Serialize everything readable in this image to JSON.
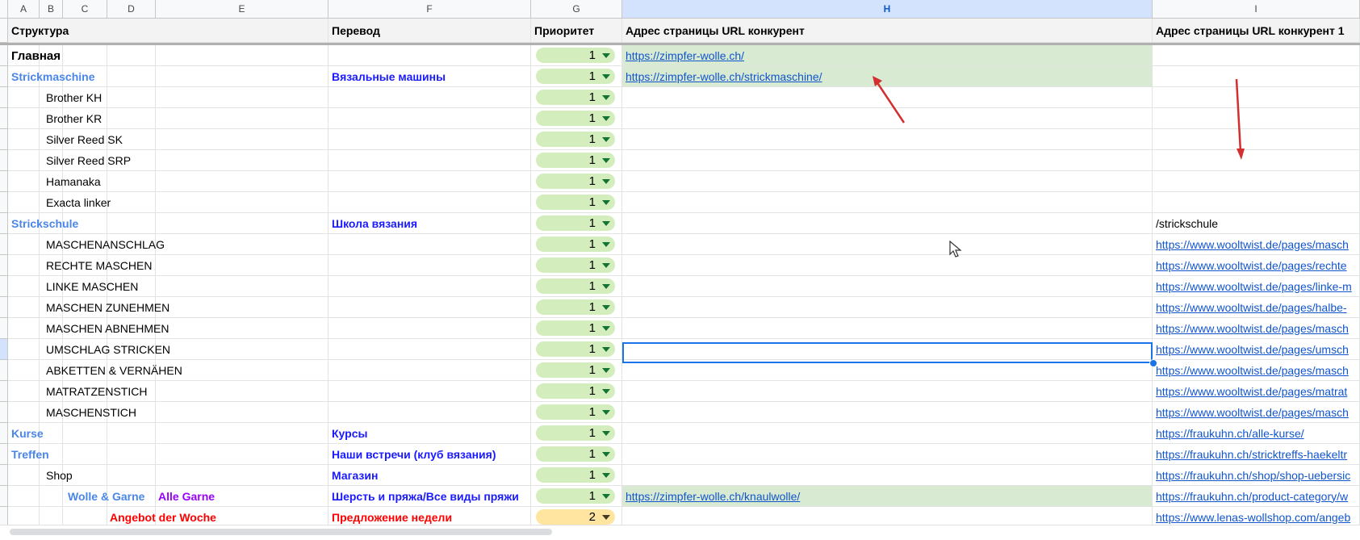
{
  "columns": [
    "A",
    "B",
    "C",
    "D",
    "E",
    "F",
    "G",
    "H",
    "I"
  ],
  "selected_column": "H",
  "header": {
    "structure": "Структура",
    "translation": "Перевод",
    "priority": "Приоритет",
    "url_competitor": "Адрес страницы URL конкурент",
    "url_competitor_1": "Адрес страницы URL конкурент 1"
  },
  "rows": [
    {
      "text": "Главная",
      "col": "A",
      "style": "bold",
      "translation": "",
      "priority": "1",
      "h": "https://zimpfer-wolle.ch/",
      "h_green": true,
      "i": ""
    },
    {
      "text": "Strickmaschine",
      "col": "A",
      "style": "lightblue",
      "translation": "Вязальные машины",
      "priority": "1",
      "h": "https://zimpfer-wolle.ch/strickmaschine/",
      "h_green": true,
      "i": ""
    },
    {
      "text": "Brother KH",
      "col": "C",
      "style": "",
      "translation": "",
      "priority": "1",
      "h": "",
      "h_green": false,
      "i": ""
    },
    {
      "text": "Brother KR",
      "col": "C",
      "style": "",
      "translation": "",
      "priority": "1",
      "h": "",
      "h_green": false,
      "i": ""
    },
    {
      "text": "Silver Reed SK",
      "col": "C",
      "style": "",
      "translation": "",
      "priority": "1",
      "h": "",
      "h_green": false,
      "i": ""
    },
    {
      "text": "Silver Reed SRP",
      "col": "C",
      "style": "",
      "translation": "",
      "priority": "1",
      "h": "",
      "h_green": false,
      "i": ""
    },
    {
      "text": "Hamanaka",
      "col": "C",
      "style": "",
      "translation": "",
      "priority": "1",
      "h": "",
      "h_green": false,
      "i": ""
    },
    {
      "text": "Exacta linker",
      "col": "C",
      "style": "",
      "translation": "",
      "priority": "1",
      "h": "",
      "h_green": false,
      "i": ""
    },
    {
      "text": "Strickschule",
      "col": "A",
      "style": "lightblue",
      "translation": "Школа вязания",
      "priority": "1",
      "h": "",
      "h_green": false,
      "i": "/strickschule",
      "i_plain": true
    },
    {
      "text": "MASCHENANSCHLAG",
      "col": "C",
      "style": "",
      "translation": "",
      "priority": "1",
      "h": "",
      "h_green": false,
      "i": "https://www.wooltwist.de/pages/masch"
    },
    {
      "text": "RECHTE MASCHEN",
      "col": "C",
      "style": "",
      "translation": "",
      "priority": "1",
      "h": "",
      "h_green": false,
      "i": "https://www.wooltwist.de/pages/rechte"
    },
    {
      "text": "LINKE MASCHEN",
      "col": "C",
      "style": "",
      "translation": "",
      "priority": "1",
      "h": "",
      "h_green": false,
      "i": "https://www.wooltwist.de/pages/linke-m"
    },
    {
      "text": "MASCHEN ZUNEHMEN",
      "col": "C",
      "style": "",
      "translation": "",
      "priority": "1",
      "h": "",
      "h_green": false,
      "i": "https://www.wooltwist.de/pages/halbe-"
    },
    {
      "text": "MASCHEN ABNEHMEN",
      "col": "C",
      "style": "",
      "translation": "",
      "priority": "1",
      "h": "",
      "h_green": false,
      "i": "https://www.wooltwist.de/pages/masch"
    },
    {
      "text": "UMSCHLAG STRICKEN",
      "col": "C",
      "style": "",
      "translation": "",
      "priority": "1",
      "h": "",
      "h_green": false,
      "i": "https://www.wooltwist.de/pages/umsch",
      "selected": true
    },
    {
      "text": "ABKETTEN & VERNÄHEN",
      "col": "C",
      "style": "",
      "translation": "",
      "priority": "1",
      "h": "",
      "h_green": false,
      "i": "https://www.wooltwist.de/pages/masch"
    },
    {
      "text": "MATRATZENSTICH",
      "col": "C",
      "style": "",
      "translation": "",
      "priority": "1",
      "h": "",
      "h_green": false,
      "i": "https://www.wooltwist.de/pages/matrat"
    },
    {
      "text": "MASCHENSTICH",
      "col": "C",
      "style": "",
      "translation": "",
      "priority": "1",
      "h": "",
      "h_green": false,
      "i": "https://www.wooltwist.de/pages/masch"
    },
    {
      "text": "Kurse",
      "col": "A",
      "style": "lightblue",
      "translation": "Курсы",
      "priority": "1",
      "h": "",
      "h_green": false,
      "i": "https://fraukuhn.ch/alle-kurse/"
    },
    {
      "text": "Treffen",
      "col": "A",
      "style": "lightblue",
      "translation": "Наши встречи (клуб вязания)",
      "priority": "1",
      "h": "",
      "h_green": false,
      "i": "https://fraukuhn.ch/stricktreffs-haekeltr"
    },
    {
      "text": "Shop",
      "col": "C",
      "style": "",
      "translation": "Магазин",
      "priority": "1",
      "h": "",
      "h_green": false,
      "i": "https://fraukuhn.ch/shop/shop-uebersic"
    },
    {
      "text": "Wolle & Garne",
      "col": "D",
      "style": "lightblue",
      "extra": "Alle Garne",
      "translation": "Шерсть и пряжа/Все виды пряжи",
      "priority": "1",
      "h": "https://zimpfer-wolle.ch/knaulwolle/",
      "h_green": true,
      "i": "https://fraukuhn.ch/product-category/w"
    },
    {
      "text": "Angebot der Woche",
      "col": "E",
      "style": "red",
      "translation": "Предложение недели",
      "priority": "2",
      "priority_color": "orange",
      "h": "",
      "h_green": false,
      "i": "https://www.lenas-wollshop.com/angeb"
    }
  ],
  "colors": {
    "selection": "#1a73e8",
    "chip_green": "#d4edbc",
    "chip_orange": "#ffe5a0",
    "green_fill": "#d9ead3",
    "arrow": "#d32f2f"
  },
  "icons": [
    "dropdown-caret-icon",
    "mouse-cursor-icon",
    "annotation-arrow-icon"
  ]
}
